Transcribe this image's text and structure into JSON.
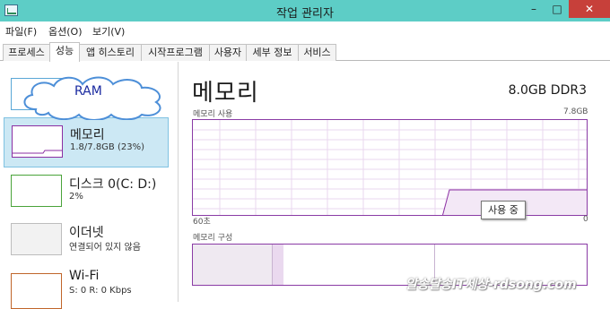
{
  "window": {
    "title": "작업 관리자"
  },
  "caption_buttons": {
    "minimize": "–",
    "maximize": "□",
    "close": "✕"
  },
  "menu": [
    "파일(F)",
    "옵션(O)",
    "보기(V)"
  ],
  "tabs": [
    "프로세스",
    "성능",
    "앱 히스토리",
    "시작프로그램",
    "사용자",
    "세부 정보",
    "서비스"
  ],
  "active_tab": "성능",
  "annotation": {
    "cloud_text": "RAM"
  },
  "sidebar": {
    "items": [
      {
        "title": "메모리",
        "sub": "1.8/7.8GB (23%)",
        "color": "#8b2fa3",
        "selected": true
      },
      {
        "title": "디스크 0(C: D:)",
        "sub": "2%",
        "color": "#4aa33a"
      },
      {
        "title": "이더넷",
        "sub": "연결되어 있지 않음",
        "color": "#bdbdbd"
      },
      {
        "title": "Wi-Fi",
        "sub": "S: 0 R: 0 Kbps",
        "color": "#c0652a"
      }
    ]
  },
  "main": {
    "title": "메모리",
    "spec": "8.0GB DDR3",
    "usage_label": "메모리 사용",
    "usage_max": "7.8GB",
    "x_left": "60초",
    "x_right": "0",
    "tooltip": "사용 중",
    "composition_label": "메모리 구성",
    "usage_fraction": 0.23,
    "accent_color": "#8b2fa3"
  },
  "watermark": "알송달송IT세상-rdsong.com"
}
